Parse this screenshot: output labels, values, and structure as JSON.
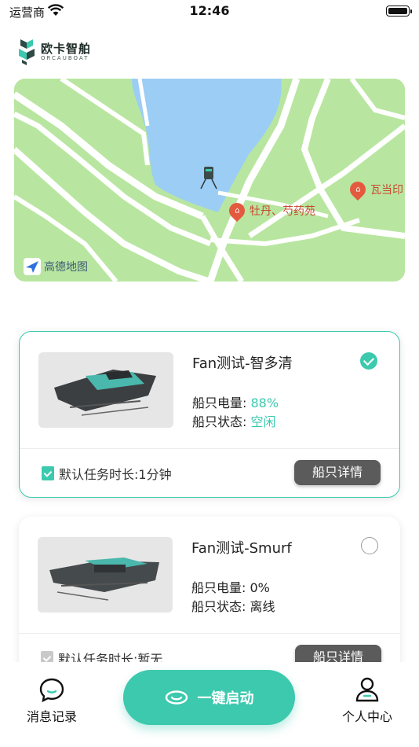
{
  "status_bar": {
    "carrier": "运营商",
    "time": "12:46"
  },
  "logo": {
    "name_cn": "欧卡智舶",
    "name_en": "ORCAUBOAT"
  },
  "map": {
    "provider": "高德地图",
    "pois": [
      "牡丹、芍药苑",
      "瓦当印"
    ],
    "colors": {
      "water": "#9ccdf5",
      "land": "#b8e6a0",
      "road": "#ffffff"
    }
  },
  "boats": [
    {
      "name": "Fan测试-智多清",
      "selected": true,
      "battery_label": "船只电量:",
      "battery_value": "88%",
      "status_label": "船只状态:",
      "status_value": "空闲",
      "task": "默认任务时长:1分钟",
      "detail_label": "船只详情"
    },
    {
      "name": "Fan测试-Smurf",
      "selected": false,
      "battery_label": "船只电量:",
      "battery_value": "0%",
      "status_label": "船只状态:",
      "status_value": "离线",
      "task": "默认任务时长:暂无",
      "detail_label": "船只详情"
    }
  ],
  "bottom_nav": {
    "messages_label": "消息记录",
    "start_label": "一键启动",
    "profile_label": "个人中心"
  },
  "colors": {
    "accent": "#3cc9ae",
    "button_dark": "#5b5b5b"
  }
}
